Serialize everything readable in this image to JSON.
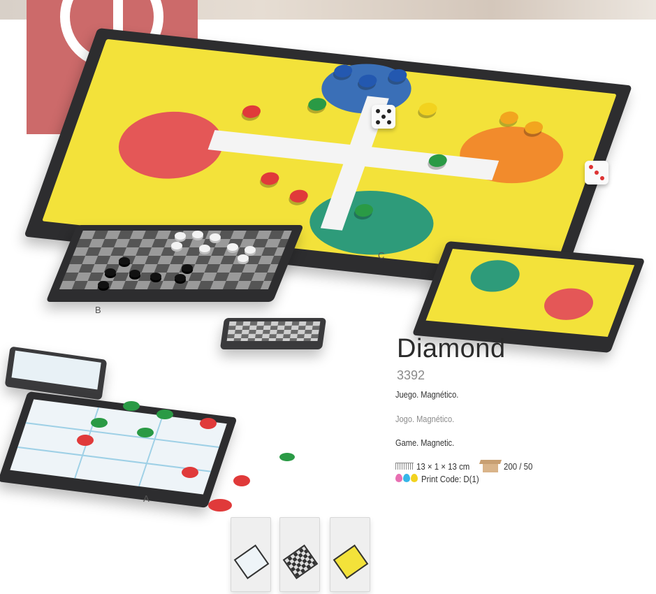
{
  "product": {
    "name": "Diamond",
    "code": "3392",
    "descriptions": {
      "es": "Juego. Magnético.",
      "pt": "Jogo. Magnético.",
      "en": "Game. Magnetic."
    },
    "dimensions": "13 × 1 × 13 cm",
    "packaging": "200 / 50",
    "print_code": "Print Code: D(1)"
  },
  "variant_labels": {
    "a": "A",
    "b": "B",
    "c": "C"
  },
  "colors": {
    "brand_box": "#cc6a6a",
    "ludo_yellow": "#f3e23a",
    "red": "#e03a3a",
    "blue": "#2358b0",
    "orange": "#f28b2c",
    "green": "#2a9a45",
    "drop_magenta": "#e86fb2",
    "drop_cyan": "#36b6e8",
    "drop_yellow": "#f2d21f"
  },
  "icons": {
    "logo": "power-logo",
    "ruler": "ruler-icon",
    "box": "box-icon",
    "ink": "ink-drops-icon"
  }
}
